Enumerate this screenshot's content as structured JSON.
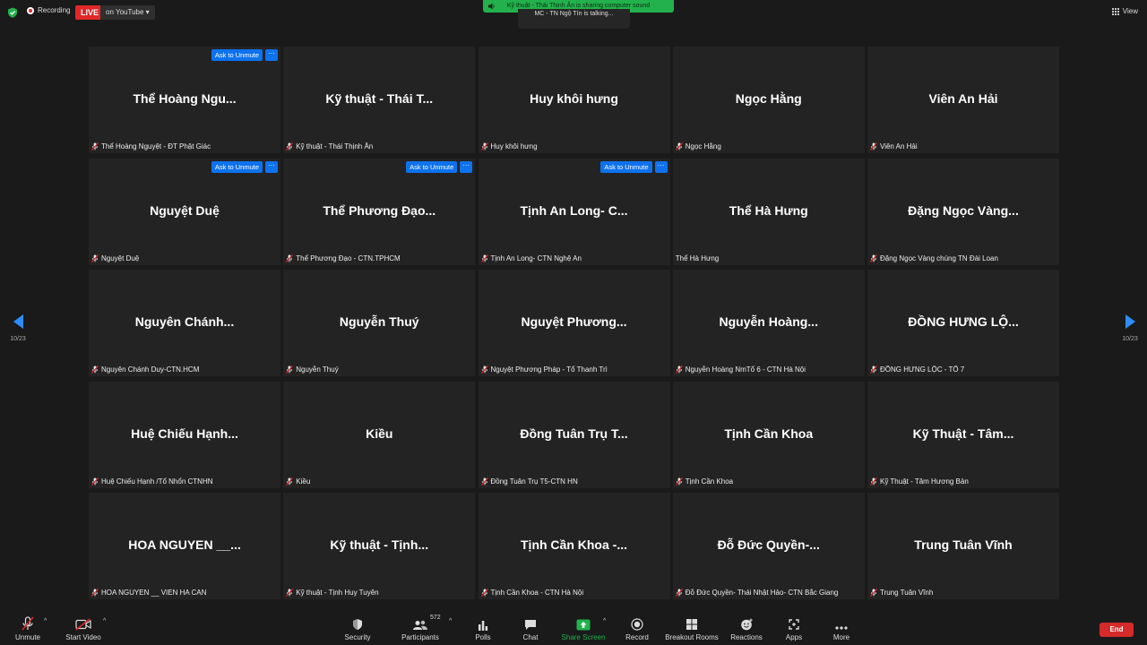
{
  "top": {
    "recording": "Recording",
    "live": "LIVE",
    "stream_target": "on YouTube",
    "share_banner": "Kỹ thuật - Thái Thịnh Ân is sharing computer sound",
    "talking": "MC - TN Ngộ Tín is talking...",
    "view": "View"
  },
  "tile_actions": {
    "ask_unmute": "Ask to Unmute",
    "more": "···"
  },
  "tiles": [
    {
      "big": "Thể Hoàng Ngu...",
      "name": "Thể Hoàng Nguyệt - ĐT Phật Giác"
    },
    {
      "big": "Kỹ thuật - Thái T...",
      "name": "Kỹ thuật - Thái Thịnh Ân"
    },
    {
      "big": "Huy khôi hưng",
      "name": "Huy khôi hưng"
    },
    {
      "big": "Ngọc Hằng",
      "name": "Ngọc Hằng"
    },
    {
      "big": "Viên An Hải",
      "name": "Viên An Hải"
    },
    {
      "big": "Nguyệt Duệ",
      "name": "Nguyệt Duệ"
    },
    {
      "big": "Thể Phương Đạo...",
      "name": "Thể Phương Đạo - CTN.TPHCM"
    },
    {
      "big": "Tịnh An Long- C...",
      "name": "Tịnh An Long- CTN Nghệ An"
    },
    {
      "big": "Thể Hà Hưng",
      "name": "Thể Hà Hưng"
    },
    {
      "big": "Đặng Ngọc Vàng...",
      "name": "Đặng Ngọc Vàng chúng TN Đài Loan"
    },
    {
      "big": "Nguyên Chánh...",
      "name": "Nguyên Chánh Duy-CTN.HCM"
    },
    {
      "big": "Nguyễn Thuý",
      "name": "Nguyễn Thuý"
    },
    {
      "big": "Nguyệt Phương...",
      "name": "Nguyệt Phương Pháp - Tổ Thanh Trì"
    },
    {
      "big": "Nguyễn Hoàng...",
      "name": "Nguyễn Hoàng NmTổ 6 - CTN Hà Nội"
    },
    {
      "big": "ĐỒNG HƯNG LỘ...",
      "name": "ĐỒNG HƯNG LỘC - TỔ 7"
    },
    {
      "big": "Huệ Chiếu Hạnh...",
      "name": "Huệ Chiếu Hạnh /Tổ Nhổn CTNHN"
    },
    {
      "big": "Kiều",
      "name": "Kiều"
    },
    {
      "big": "Đồng Tuân Trụ T...",
      "name": "Đồng Tuân Trụ T5-CTN HN"
    },
    {
      "big": "Tịnh Cần Khoa",
      "name": "Tịnh Cần Khoa"
    },
    {
      "big": "Kỹ Thuật - Tâm...",
      "name": "Kỹ Thuật - Tâm Hương Bản"
    },
    {
      "big": "HOA NGUYEN __...",
      "name": "HOA NGUYEN __ VIEN HA CAN"
    },
    {
      "big": "Kỹ thuật - Tịnh...",
      "name": "Kỹ thuật - Tịnh Huy Tuyên"
    },
    {
      "big": "Tịnh Cần Khoa -...",
      "name": "Tịnh Cần Khoa - CTN Hà Nội"
    },
    {
      "big": "Đỗ Đức Quyền-...",
      "name": "Đỗ Đức Quyền- Thái Nhật Hảo- CTN Bắc Giang"
    },
    {
      "big": "Trung Tuân Vĩnh",
      "name": "Trung Tuân Vĩnh"
    }
  ],
  "paging": {
    "left": "10/23",
    "right": "10/23"
  },
  "toolbar": {
    "unmute": "Unmute",
    "start_video": "Start Video",
    "security": "Security",
    "participants": "Participants",
    "participants_count": "572",
    "polls": "Polls",
    "chat": "Chat",
    "share_screen": "Share Screen",
    "record": "Record",
    "breakout": "Breakout Rooms",
    "reactions": "Reactions",
    "apps": "Apps",
    "more": "More",
    "end": "End"
  },
  "colors": {
    "accent": "#0e72ed",
    "live": "#e02828",
    "share_green": "#22b14c",
    "end": "#d52a2a"
  }
}
